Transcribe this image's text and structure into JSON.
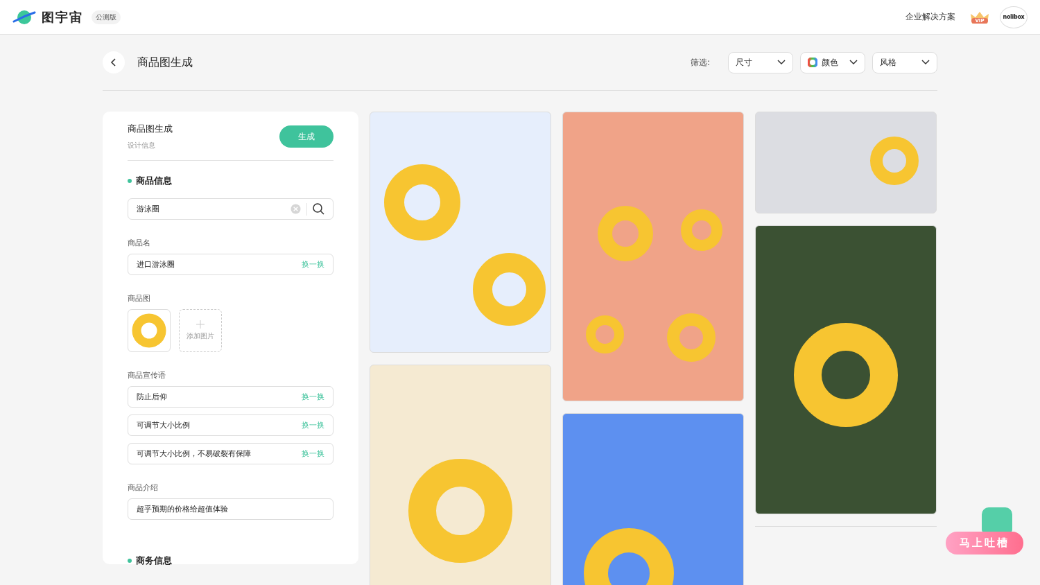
{
  "header": {
    "logo_text": "图宇宙",
    "badge": "公测版",
    "enterprise_link": "企业解决方案",
    "vip_label": "VIP",
    "avatar_text": "nolibox"
  },
  "page_title": "商品图生成",
  "filter_label": "筛选:",
  "filters": [
    {
      "label": "尺寸",
      "kind": "plain"
    },
    {
      "label": "颜色",
      "kind": "color"
    },
    {
      "label": "风格",
      "kind": "plain"
    }
  ],
  "panel": {
    "title": "商品图生成",
    "subtitle": "设计信息",
    "generate_button": "生成",
    "product_section": "商品信息",
    "search": {
      "value": "游泳圈"
    },
    "name_label": "商品名",
    "name_field": {
      "value": "进口游泳圈",
      "action": "换一换"
    },
    "image_label": "商品图",
    "add_image": "添加图片",
    "slogan_label": "商品宣传语",
    "slogans": [
      {
        "value": "防止后仰",
        "action": "换一换"
      },
      {
        "value": "可调节大小比例",
        "action": "换一换"
      },
      {
        "value": "可调节大小比例，不易破裂有保障",
        "action": "换一换"
      }
    ],
    "intro_label": "商品介绍",
    "intro_field": {
      "value": "超乎预期的价格给超值体验"
    },
    "business_section": "商务信息"
  },
  "gallery": [
    [
      {
        "kind": "blue"
      },
      {
        "kind": "cream"
      }
    ],
    [
      {
        "kind": "salmon"
      },
      {
        "kind": "sky"
      }
    ],
    [
      {
        "kind": "grey"
      },
      {
        "kind": "green"
      }
    ]
  ],
  "feedback_button": "马上吐槽"
}
